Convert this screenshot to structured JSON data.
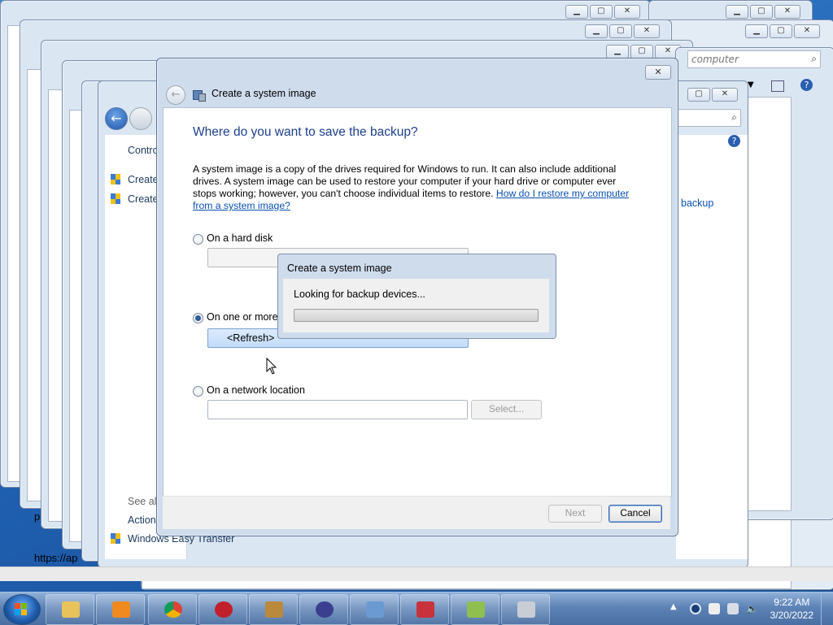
{
  "background_windows": {
    "search_placeholder": "computer",
    "sidebar_items": [
      "Create",
      "Create"
    ],
    "control_label": "Contro",
    "see_also": "See als",
    "action_label": "Action",
    "easy_transfer": "Windows Easy Transfer",
    "right_link": "backup",
    "address_text": "https://ap",
    "lower_label": "p"
  },
  "dialog": {
    "title": "Create a system image",
    "heading": "Where do you want to save the backup?",
    "description": "A system image is a copy of the drives required for Windows to run. It can also include additional drives. A system image can be used to restore your computer if your hard drive or computer ever stops working; however, you can't choose individual items to restore. ",
    "help_link": "How do I restore my computer from a system image?",
    "options": {
      "hard_disk": "On a hard disk",
      "dvds": "On one or more",
      "network": "On a network location"
    },
    "refresh_label": "<Refresh>",
    "select_label": "Select...",
    "next_label": "Next",
    "cancel_label": "Cancel",
    "close_glyph": "✕"
  },
  "progress_popup": {
    "title": "Create a system image",
    "message": "Looking for backup devices...",
    "progress": 0.0
  },
  "taskbar": {
    "time": "9:22 AM",
    "date": "3/20/2022",
    "apps": [
      "explorer-icon",
      "media-player-icon",
      "chrome-icon",
      "security-app-icon",
      "lock-app-icon",
      "app-icon",
      "control-panel-icon",
      "toolbox-icon",
      "backup-icon",
      "drive-icon"
    ]
  },
  "colors": {
    "heading": "#1d3f8c",
    "link": "#0a50b0",
    "accent": "#2c5d96"
  }
}
